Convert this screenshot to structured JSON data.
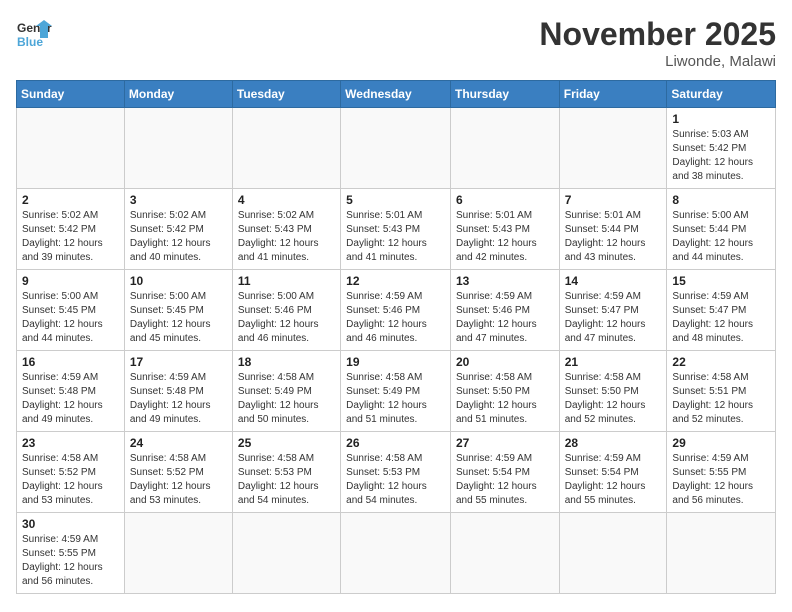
{
  "header": {
    "title": "November 2025",
    "location": "Liwonde, Malawi",
    "logo_general": "General",
    "logo_blue": "Blue"
  },
  "weekdays": [
    "Sunday",
    "Monday",
    "Tuesday",
    "Wednesday",
    "Thursday",
    "Friday",
    "Saturday"
  ],
  "weeks": [
    [
      {
        "day": "",
        "info": ""
      },
      {
        "day": "",
        "info": ""
      },
      {
        "day": "",
        "info": ""
      },
      {
        "day": "",
        "info": ""
      },
      {
        "day": "",
        "info": ""
      },
      {
        "day": "",
        "info": ""
      },
      {
        "day": "1",
        "info": "Sunrise: 5:03 AM\nSunset: 5:42 PM\nDaylight: 12 hours\nand 38 minutes."
      }
    ],
    [
      {
        "day": "2",
        "info": "Sunrise: 5:02 AM\nSunset: 5:42 PM\nDaylight: 12 hours\nand 39 minutes."
      },
      {
        "day": "3",
        "info": "Sunrise: 5:02 AM\nSunset: 5:42 PM\nDaylight: 12 hours\nand 40 minutes."
      },
      {
        "day": "4",
        "info": "Sunrise: 5:02 AM\nSunset: 5:43 PM\nDaylight: 12 hours\nand 41 minutes."
      },
      {
        "day": "5",
        "info": "Sunrise: 5:01 AM\nSunset: 5:43 PM\nDaylight: 12 hours\nand 41 minutes."
      },
      {
        "day": "6",
        "info": "Sunrise: 5:01 AM\nSunset: 5:43 PM\nDaylight: 12 hours\nand 42 minutes."
      },
      {
        "day": "7",
        "info": "Sunrise: 5:01 AM\nSunset: 5:44 PM\nDaylight: 12 hours\nand 43 minutes."
      },
      {
        "day": "8",
        "info": "Sunrise: 5:00 AM\nSunset: 5:44 PM\nDaylight: 12 hours\nand 44 minutes."
      }
    ],
    [
      {
        "day": "9",
        "info": "Sunrise: 5:00 AM\nSunset: 5:45 PM\nDaylight: 12 hours\nand 44 minutes."
      },
      {
        "day": "10",
        "info": "Sunrise: 5:00 AM\nSunset: 5:45 PM\nDaylight: 12 hours\nand 45 minutes."
      },
      {
        "day": "11",
        "info": "Sunrise: 5:00 AM\nSunset: 5:46 PM\nDaylight: 12 hours\nand 46 minutes."
      },
      {
        "day": "12",
        "info": "Sunrise: 4:59 AM\nSunset: 5:46 PM\nDaylight: 12 hours\nand 46 minutes."
      },
      {
        "day": "13",
        "info": "Sunrise: 4:59 AM\nSunset: 5:46 PM\nDaylight: 12 hours\nand 47 minutes."
      },
      {
        "day": "14",
        "info": "Sunrise: 4:59 AM\nSunset: 5:47 PM\nDaylight: 12 hours\nand 47 minutes."
      },
      {
        "day": "15",
        "info": "Sunrise: 4:59 AM\nSunset: 5:47 PM\nDaylight: 12 hours\nand 48 minutes."
      }
    ],
    [
      {
        "day": "16",
        "info": "Sunrise: 4:59 AM\nSunset: 5:48 PM\nDaylight: 12 hours\nand 49 minutes."
      },
      {
        "day": "17",
        "info": "Sunrise: 4:59 AM\nSunset: 5:48 PM\nDaylight: 12 hours\nand 49 minutes."
      },
      {
        "day": "18",
        "info": "Sunrise: 4:58 AM\nSunset: 5:49 PM\nDaylight: 12 hours\nand 50 minutes."
      },
      {
        "day": "19",
        "info": "Sunrise: 4:58 AM\nSunset: 5:49 PM\nDaylight: 12 hours\nand 51 minutes."
      },
      {
        "day": "20",
        "info": "Sunrise: 4:58 AM\nSunset: 5:50 PM\nDaylight: 12 hours\nand 51 minutes."
      },
      {
        "day": "21",
        "info": "Sunrise: 4:58 AM\nSunset: 5:50 PM\nDaylight: 12 hours\nand 52 minutes."
      },
      {
        "day": "22",
        "info": "Sunrise: 4:58 AM\nSunset: 5:51 PM\nDaylight: 12 hours\nand 52 minutes."
      }
    ],
    [
      {
        "day": "23",
        "info": "Sunrise: 4:58 AM\nSunset: 5:52 PM\nDaylight: 12 hours\nand 53 minutes."
      },
      {
        "day": "24",
        "info": "Sunrise: 4:58 AM\nSunset: 5:52 PM\nDaylight: 12 hours\nand 53 minutes."
      },
      {
        "day": "25",
        "info": "Sunrise: 4:58 AM\nSunset: 5:53 PM\nDaylight: 12 hours\nand 54 minutes."
      },
      {
        "day": "26",
        "info": "Sunrise: 4:58 AM\nSunset: 5:53 PM\nDaylight: 12 hours\nand 54 minutes."
      },
      {
        "day": "27",
        "info": "Sunrise: 4:59 AM\nSunset: 5:54 PM\nDaylight: 12 hours\nand 55 minutes."
      },
      {
        "day": "28",
        "info": "Sunrise: 4:59 AM\nSunset: 5:54 PM\nDaylight: 12 hours\nand 55 minutes."
      },
      {
        "day": "29",
        "info": "Sunrise: 4:59 AM\nSunset: 5:55 PM\nDaylight: 12 hours\nand 56 minutes."
      }
    ],
    [
      {
        "day": "30",
        "info": "Sunrise: 4:59 AM\nSunset: 5:55 PM\nDaylight: 12 hours\nand 56 minutes."
      },
      {
        "day": "",
        "info": ""
      },
      {
        "day": "",
        "info": ""
      },
      {
        "day": "",
        "info": ""
      },
      {
        "day": "",
        "info": ""
      },
      {
        "day": "",
        "info": ""
      },
      {
        "day": "",
        "info": ""
      }
    ]
  ]
}
